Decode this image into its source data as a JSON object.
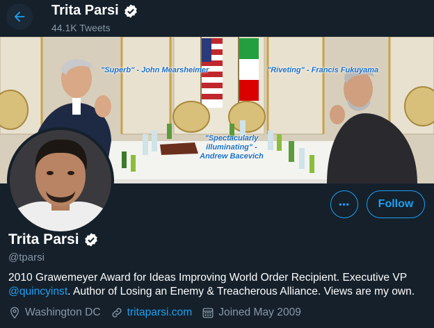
{
  "header": {
    "name": "Trita Parsi",
    "tweet_count": "44.1K Tweets"
  },
  "banner": {
    "quotes": [
      "\"Superb\" - John Mearsheimer",
      "\"Riveting\" - Francis Fukuyama",
      "\"Spectacularly",
      "illuminating\" -",
      "Andrew Bacevich"
    ]
  },
  "actions": {
    "more_label": "•••",
    "follow_label": "Follow"
  },
  "profile": {
    "name": "Trita Parsi",
    "handle": "@tparsi",
    "bio_line1": "2010 Grawemeyer Award for Ideas Improving World Order Recipient. Executive VP",
    "bio_mention": "@quincyinst",
    "bio_line2_rest": ". Author of Losing an Enemy & Treacherous Alliance. Views are my own.",
    "location": "Washington DC",
    "website": "tritaparsi.com",
    "joined": "Joined May 2009"
  },
  "colors": {
    "background": "#15202b",
    "accent": "#1da1f2",
    "secondary_text": "#8899a6",
    "verified_badge": "#ffffff"
  },
  "icons": [
    "back-arrow-icon",
    "verified-badge-icon",
    "more-icon",
    "location-pin-icon",
    "link-icon",
    "calendar-icon"
  ]
}
